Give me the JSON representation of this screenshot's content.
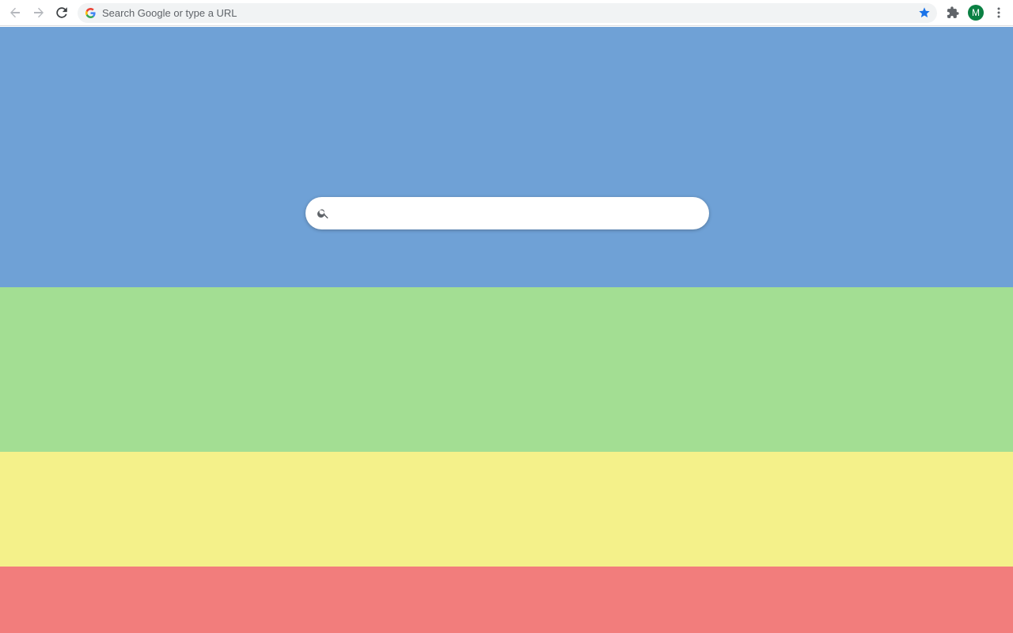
{
  "browser": {
    "omnibox_placeholder": "Search Google or type a URL",
    "profile_initial": "M",
    "icons": {
      "back": "arrow-back-icon",
      "forward": "arrow-forward-icon",
      "reload": "reload-icon",
      "omnibox": "google-g-icon",
      "bookmark": "star-icon",
      "extensions": "puzzle-icon",
      "menu": "kebab-menu-icon"
    },
    "colors": {
      "bookmark_star": "#1a73e8",
      "avatar": "#0b8043"
    }
  },
  "page": {
    "bands": [
      {
        "name": "blue",
        "color": "#6fa1d6"
      },
      {
        "name": "green",
        "color": "#a3de93"
      },
      {
        "name": "yellow",
        "color": "#f4f18a"
      },
      {
        "name": "red",
        "color": "#f27d7c"
      }
    ],
    "search": {
      "placeholder": "",
      "value": "",
      "icon": "search-icon"
    }
  }
}
